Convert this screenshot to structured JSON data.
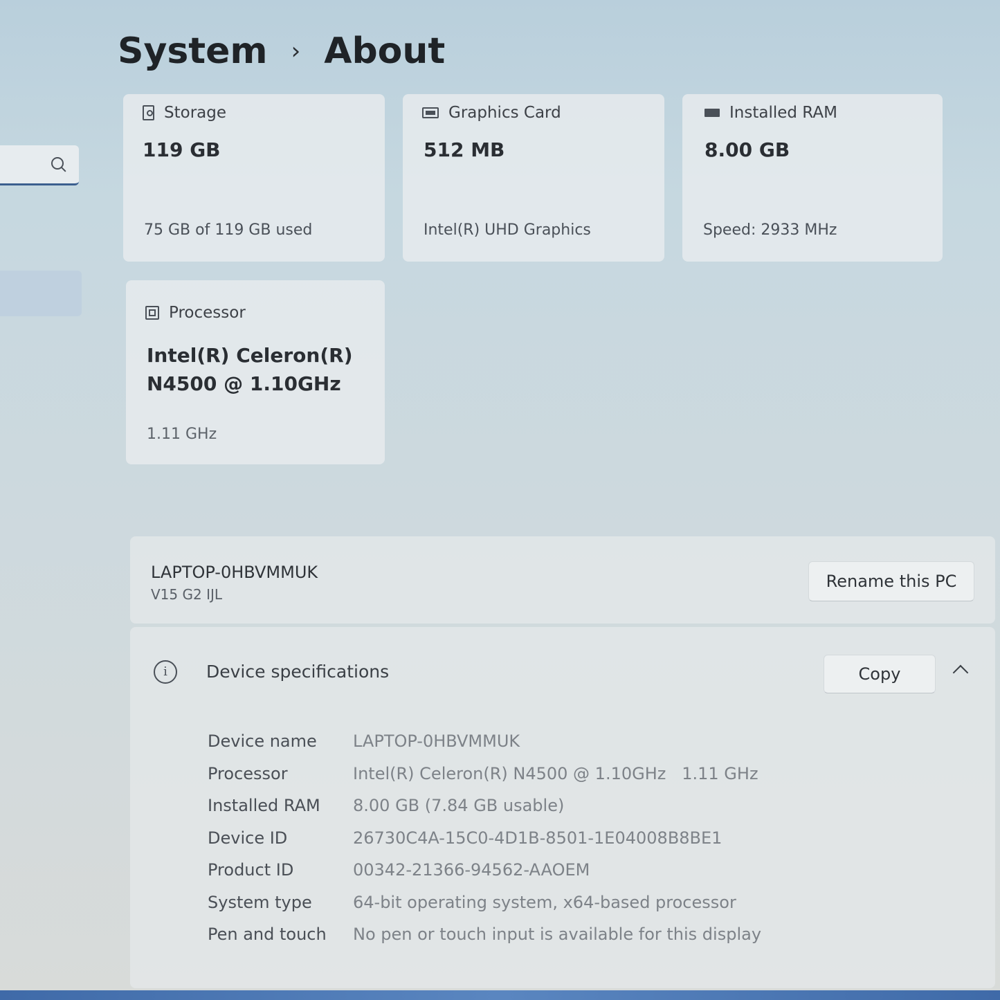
{
  "breadcrumb": {
    "parent": "System",
    "separator": "›",
    "current": "About"
  },
  "cards": {
    "storage": {
      "title": "Storage",
      "value": "119 GB",
      "detail": "75 GB of 119 GB used"
    },
    "graphics": {
      "title": "Graphics Card",
      "value": "512 MB",
      "detail": "Intel(R) UHD Graphics"
    },
    "ram": {
      "title": "Installed RAM",
      "value": "8.00 GB",
      "detail": "Speed: 2933 MHz"
    },
    "processor": {
      "title": "Processor",
      "value_line1": "Intel(R) Celeron(R)",
      "value_line2": "N4500 @ 1.10GHz",
      "detail": "1.11 GHz"
    }
  },
  "pc": {
    "name": "LAPTOP-0HBVMMUK",
    "model": "V15 G2 IJL",
    "rename_label": "Rename this PC"
  },
  "device_specs": {
    "title": "Device specifications",
    "copy_label": "Copy",
    "rows": [
      {
        "label": "Device name",
        "value": "LAPTOP-0HBVMMUK"
      },
      {
        "label": "Processor",
        "value": "Intel(R) Celeron(R) N4500 @ 1.10GHz   1.11 GHz"
      },
      {
        "label": "Installed RAM",
        "value": "8.00 GB (7.84 GB usable)"
      },
      {
        "label": "Device ID",
        "value": "26730C4A-15C0-4D1B-8501-1E04008B8BE1"
      },
      {
        "label": "Product ID",
        "value": "00342-21366-94562-AAOEM"
      },
      {
        "label": "System type",
        "value": "64-bit operating system, x64-based processor"
      },
      {
        "label": "Pen and touch",
        "value": "No pen or touch input is available for this display"
      }
    ]
  }
}
